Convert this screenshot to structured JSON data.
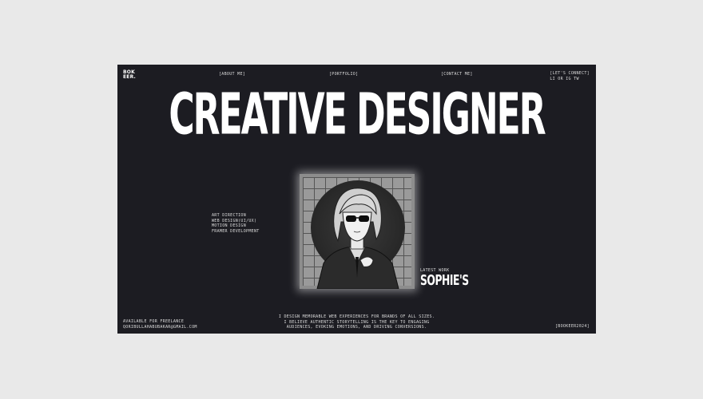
{
  "header": {
    "logo_line1": "BOK",
    "logo_line2": "EER.",
    "nav": [
      "[ABOUT ME]",
      "[PORTFOLIO]",
      "[CONTACT ME]"
    ],
    "connect_line1": "[LET'S CONNECT]",
    "connect_line2": "LI OR IG TW"
  },
  "hero": {
    "title": "CREATIVE DESIGNER"
  },
  "services": [
    "ART DIRECTION",
    "WEB DESIGN(UI/UX)",
    "MOTION DESIGN",
    "FRAMER DEVELOPMENT"
  ],
  "latest": {
    "label": "LATEST WORK",
    "title": "SOPHIE'S"
  },
  "blurb": [
    "I DESIGN MEMORABLE WEB EXPERIENCES FOR BRANDS OF ALL SIZES.",
    "I BELIEVE AUTHENTIC STORYTELLING IS THE KEY TO ENGAGING",
    "AUDIENCES, EVOKING EMOTIONS, AND DRIVING CONVERSIONS."
  ],
  "footer": {
    "availability": "AVAILABLE FOR FREELANCE",
    "email": "QORIBULLAHABUBAKAR@GMAIL.COM",
    "copyright": "[BOOKEER2024]"
  },
  "colors": {
    "page_bg": "#e9e9e9",
    "frame_bg": "#1c1c22",
    "text": "#ffffff"
  }
}
